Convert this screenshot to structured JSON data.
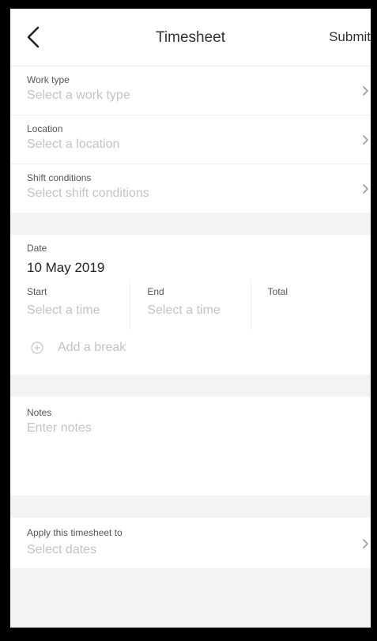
{
  "header": {
    "back_icon": "chevron-left-icon",
    "title": "Timesheet",
    "submit_label": "Submit"
  },
  "details": {
    "work_type": {
      "label": "Work type",
      "placeholder": "Select a work type"
    },
    "location": {
      "label": "Location",
      "placeholder": "Select a location"
    },
    "shift_conditions": {
      "label": "Shift conditions",
      "placeholder": "Select shift conditions"
    }
  },
  "date": {
    "label": "Date",
    "value": "10 May 2019",
    "start": {
      "label": "Start",
      "placeholder": "Select a time"
    },
    "end": {
      "label": "End",
      "placeholder": "Select a time"
    },
    "total": {
      "label": "Total",
      "value": ""
    },
    "add_break": {
      "icon": "plus-circle-icon",
      "label": "Add a break"
    }
  },
  "notes": {
    "label": "Notes",
    "placeholder": "Enter notes"
  },
  "apply": {
    "label": "Apply this timesheet to",
    "placeholder": "Select dates"
  },
  "colors": {
    "placeholder": "#c3c3c3",
    "label": "#555555",
    "background": "#f3f3f3"
  }
}
